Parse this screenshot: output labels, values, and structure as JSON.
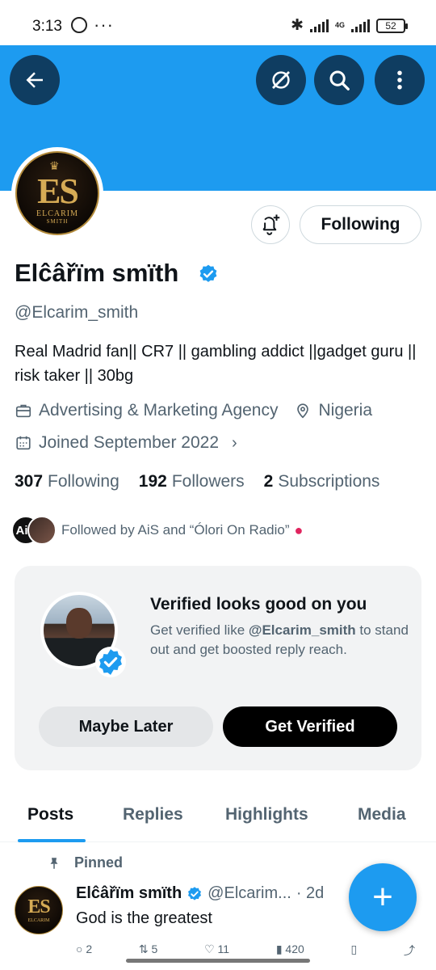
{
  "status_bar": {
    "time": "3:13",
    "network": "4G",
    "battery": "52"
  },
  "header": {
    "back_icon": "arrow-left-icon",
    "grok_icon": "grok-icon",
    "search_icon": "search-icon",
    "more_icon": "more-vertical-icon",
    "banner_color": "#1d9bf0"
  },
  "profile": {
    "avatar_initials": "ES",
    "avatar_name": "ELCARIM",
    "avatar_surname": "SMITH",
    "following_button": "Following",
    "display_name": "Elĉâřïm smïth",
    "handle": "@Elcarim_smith",
    "bio": "Real Madrid fan|| CR7 || gambling addict ||gadget guru || risk taker || 30bg",
    "category": "Advertising & Marketing Agency",
    "location": "Nigeria",
    "joined": "Joined September 2022",
    "stats": {
      "following_count": "307",
      "following_label": "Following",
      "followers_count": "192",
      "followers_label": "Followers",
      "subs_count": "2",
      "subs_label": "Subscriptions"
    },
    "followed_by_avatar_text": "AiS",
    "followed_by": "Followed by AiS and “Ólori On Radio”"
  },
  "verified_card": {
    "title": "Verified looks good on you",
    "desc_prefix": "Get verified like ",
    "desc_handle": "@Elcarim_smith",
    "desc_suffix": " to stand out and get boosted reply reach.",
    "later_label": "Maybe Later",
    "get_label": "Get Verified"
  },
  "tabs": [
    "Posts",
    "Replies",
    "Highlights",
    "Media"
  ],
  "active_tab": "Posts",
  "pinned_post": {
    "pinned_label": "Pinned",
    "name": "Elĉâřïm smïth",
    "handle": "@Elcarim...",
    "time": "· 2d",
    "text": "God is the greatest",
    "reply_count": "2",
    "repost_count": "5",
    "like_count": "11",
    "view_count": "420"
  },
  "fab_icon": "plus-icon",
  "colors": {
    "accent": "#1d9bf0",
    "header_btn": "#0f3d61",
    "secondary_text": "#536471"
  }
}
